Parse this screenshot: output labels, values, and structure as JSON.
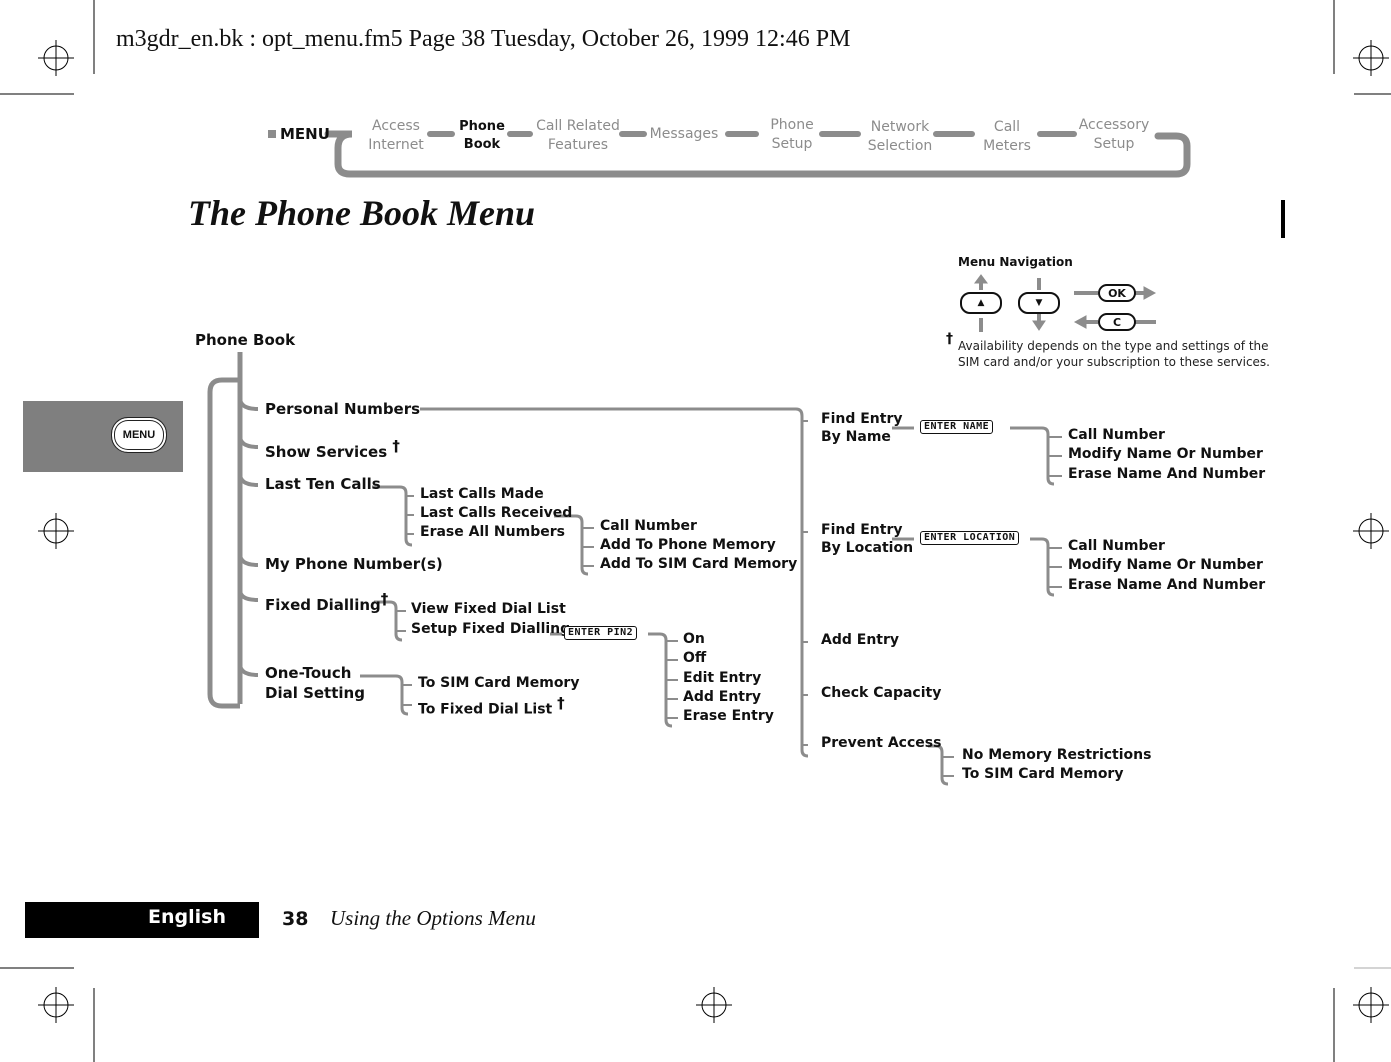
{
  "print_header": "m3gdr_en.bk : opt_menu.fm5  Page 38  Tuesday, October 26, 1999  12:46 PM",
  "nav_strip": {
    "root_label": "MENU",
    "items": [
      {
        "label": "Access\nInternet",
        "active": false
      },
      {
        "label": "Phone\nBook",
        "active": true
      },
      {
        "label": "Call Related\nFeatures",
        "active": false
      },
      {
        "label": "Messages",
        "active": false
      },
      {
        "label": "Phone\nSetup",
        "active": false
      },
      {
        "label": "Network\nSelection",
        "active": false
      },
      {
        "label": "Call\nMeters",
        "active": false
      },
      {
        "label": "Accessory\nSetup",
        "active": false
      }
    ]
  },
  "page_title": "The Phone Book Menu",
  "side_tab": {
    "key_label": "MENU"
  },
  "legend": {
    "title": "Menu Navigation",
    "up_key": "▲",
    "down_key": "▼",
    "ok_key": "OK",
    "c_key": "C",
    "footnote_mark": "†",
    "footnote": "Availability depends on the type and settings of the\nSIM card and/or your subscription to these services."
  },
  "tree": {
    "root": "Phone Book",
    "dagger": "†",
    "level1": [
      {
        "label": "Personal Numbers"
      },
      {
        "label": "Show Services",
        "dagger": true
      },
      {
        "label": "Last Ten Calls"
      },
      {
        "label": "My Phone Number(s)"
      },
      {
        "label": "Fixed Dialling",
        "dagger": true
      },
      {
        "label": "One-Touch\nDial Setting"
      }
    ],
    "last_ten_calls": [
      "Last Calls Made",
      "Last Calls Received",
      "Erase All Numbers"
    ],
    "last_calls_received": [
      "Call Number",
      "Add To Phone Memory",
      "Add To SIM Card Memory"
    ],
    "fixed_dialling": [
      "View Fixed Dial List",
      "Setup Fixed Dialling"
    ],
    "setup_fixed_dialling_prompt": "ENTER PIN2",
    "setup_fixed_dialling": [
      "On",
      "Off",
      "Edit Entry",
      "Add Entry",
      "Erase Entry"
    ],
    "one_touch": [
      {
        "label": "To SIM Card Memory"
      },
      {
        "label": "To Fixed Dial List",
        "dagger": true
      }
    ],
    "personal_numbers": [
      {
        "label": "Find Entry\nBy Name",
        "prompt": "ENTER NAME"
      },
      {
        "label": "Find Entry\nBy Location",
        "prompt": "ENTER LOCATION"
      },
      {
        "label": "Add Entry"
      },
      {
        "label": "Check Capacity"
      },
      {
        "label": "Prevent Access"
      }
    ],
    "find_by_name": [
      "Call Number",
      "Modify Name Or Number",
      "Erase Name And Number"
    ],
    "find_by_location": [
      "Call Number",
      "Modify Name Or Number",
      "Erase Name And Number"
    ],
    "prevent_access": [
      "No Memory Restrictions",
      "To SIM Card Memory"
    ]
  },
  "footer": {
    "language": "English",
    "page_number": "38",
    "section": "Using the Options Menu"
  },
  "colors": {
    "connector_gray": "#8c8c8c",
    "side_tab_gray": "#7f7f7f",
    "text": "#111111"
  }
}
